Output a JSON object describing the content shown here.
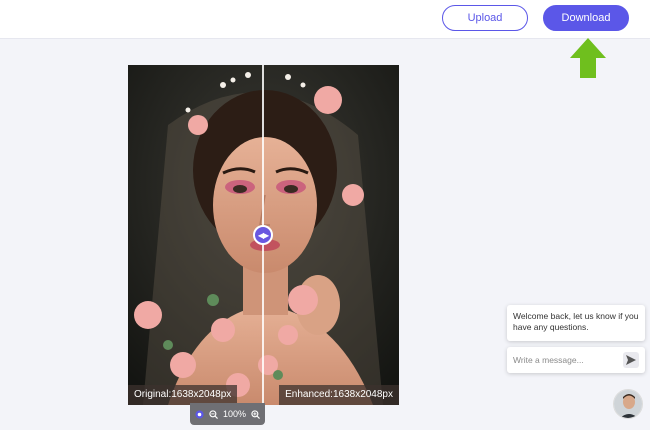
{
  "header": {
    "upload_label": "Upload",
    "download_label": "Download"
  },
  "colors": {
    "accent": "#5b57e8",
    "arrow": "#6fbf1e",
    "handle": "#6a58e0"
  },
  "compare": {
    "original_label": "Original:1638x2048px",
    "enhanced_label": "Enhanced:1638x2048px",
    "handle_icon": "left-right-arrows-icon"
  },
  "zoom": {
    "level": "100%",
    "icons": [
      "reset-icon",
      "zoom-out-icon",
      "zoom-in-icon"
    ]
  },
  "chat": {
    "message": "Welcome back, let us know if you have any questions.",
    "placeholder": "Write a message...",
    "send_icon": "send-icon"
  }
}
